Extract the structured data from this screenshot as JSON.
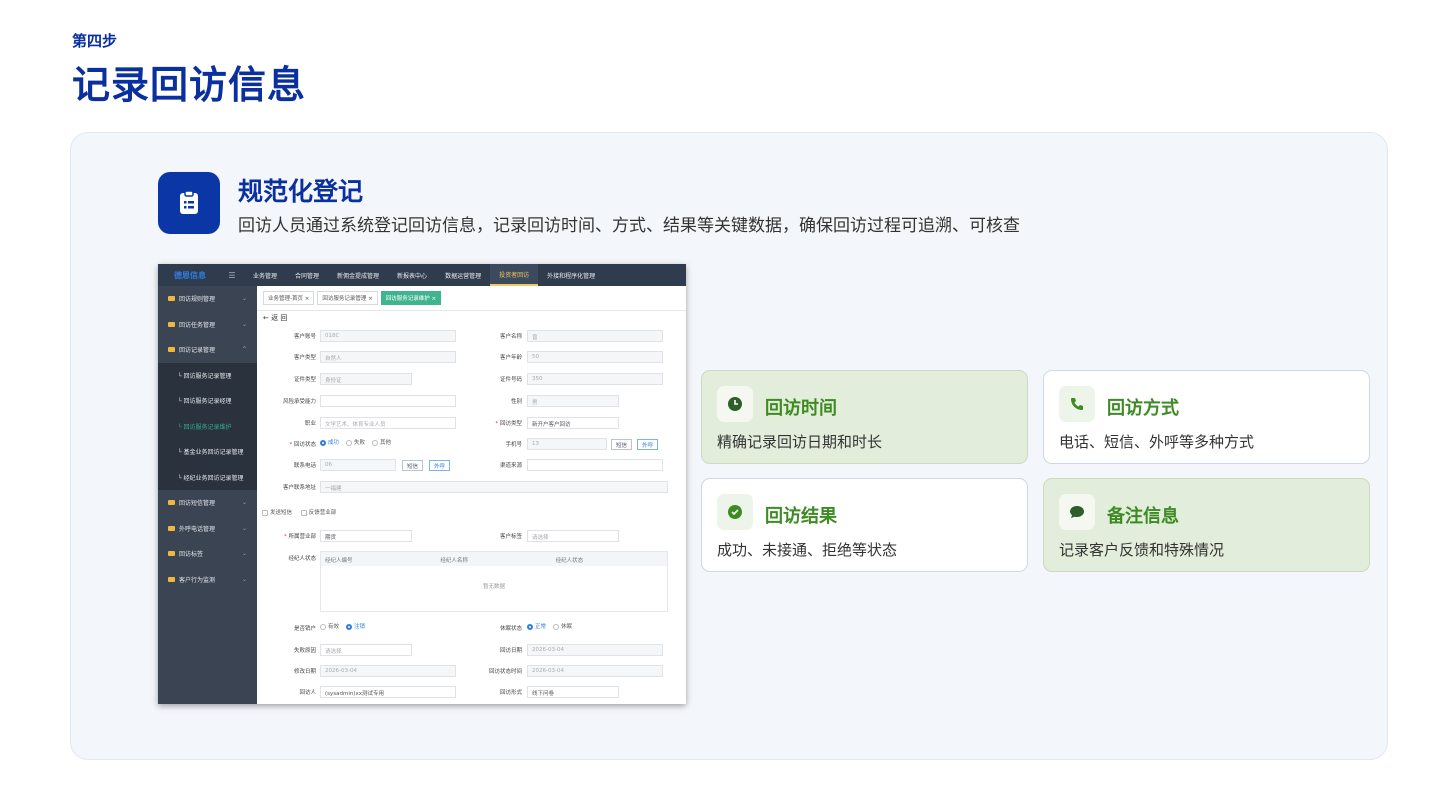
{
  "step_label": "第四步",
  "page_title": "记录回访信息",
  "feature": {
    "title": "规范化登记",
    "description": "回访人员通过系统登记回访信息，记录回访时间、方式、结果等关键数据，确保回访过程可追溯、可核查",
    "icon": "clipboard-icon"
  },
  "screenshot": {
    "logo": "德恩信息",
    "topnav": [
      "业务管理",
      "合同管理",
      "新佣金提成管理",
      "新报表中心",
      "数据运营管理",
      "投资者回访",
      "外接和程序化管理"
    ],
    "topnav_active": "投资者回访",
    "sidebar": [
      {
        "label": "回访规则管理",
        "chev": "⌄"
      },
      {
        "label": "回访任务管理",
        "chev": "⌄"
      },
      {
        "label": "回访记录管理",
        "chev": "^"
      }
    ],
    "sidebar_sub": [
      "└ 回访服务记录管理",
      "└ 回访服务记录经理",
      "└ 回访服务记录维护",
      "└ 基金业务回访记录管理",
      "└ 经纪业务回访记录管理"
    ],
    "sidebar_after": [
      {
        "label": "回访短信管理",
        "chev": "⌄"
      },
      {
        "label": "外呼电话管理",
        "chev": "⌄"
      },
      {
        "label": "回访标签",
        "chev": "⌄"
      },
      {
        "label": "客户行为监测",
        "chev": "⌄"
      }
    ],
    "tabs": [
      "业务管理-首页 ×",
      "回访服务记录管理 ×",
      "回访服务记录维护 ×"
    ],
    "back": "← 返 回",
    "labels": {
      "acct": "客户账号",
      "name": "客户名称",
      "ctype": "客户类型",
      "age": "客户年龄",
      "idtype": "证件类型",
      "idno": "证件号码",
      "risk": "风险承受能力",
      "gender": "性别",
      "job": "职业",
      "vtype": "回访类型",
      "vstatus": "回访状态",
      "mobile": "手机号",
      "phone": "联系电话",
      "source": "渠道来源",
      "addr": "客户联系地址",
      "sms": "发送短信",
      "feedback": "反馈营业部",
      "dept": "所属营业部",
      "tag": "客户标签",
      "broker": "经纪人状态",
      "canceled": "是否销户",
      "dormant": "休眠状态",
      "lost": "失败原因",
      "vdate": "回访日期",
      "mdate": "修改日期",
      "vsdate": "回访状态时间",
      "visitor": "回访人",
      "vform": "回访形式"
    },
    "values": {
      "acct": "018C",
      "name": "曾",
      "ctype": "自然人",
      "age": "50",
      "idtype": "身份证",
      "idno": "350",
      "gender": "男",
      "job": "文学艺术、体育专业人员",
      "vtype": "新开户客户回访",
      "vstatus_opts": [
        "成功",
        "失败",
        "其他"
      ],
      "mobile": "13",
      "phone": "06",
      "addr": "一福建",
      "dept": "期货",
      "tag": "请选择",
      "canceled_opts": [
        "有效",
        "注销"
      ],
      "dormant_opts": [
        "正常",
        "休眠"
      ],
      "lost": "请选择",
      "vdate": "2026-03-04",
      "mdate": "2026-03-04",
      "vsdate": "2026-03-04",
      "visitor": "(sysadmin)xx测试专用",
      "vform": "线下问卷"
    },
    "btn_sms": "短信",
    "btn_call": "外呼",
    "table_headers": [
      "经纪人编号",
      "经纪人名称",
      "经纪人状态"
    ],
    "table_empty": "暂无数据"
  },
  "cards": [
    {
      "title": "回访时间",
      "desc": "精确记录回访日期和时长",
      "icon": "clock-icon",
      "style": "green"
    },
    {
      "title": "回访方式",
      "desc": "电话、短信、外呼等多种方式",
      "icon": "phone-icon",
      "style": "white"
    },
    {
      "title": "回访结果",
      "desc": "成功、未接通、拒绝等状态",
      "icon": "check-circle-icon",
      "style": "white"
    },
    {
      "title": "备注信息",
      "desc": "记录客户反馈和特殊情况",
      "icon": "chat-bubble-icon",
      "style": "green"
    }
  ],
  "colors": {
    "brand": "#0a2f9e",
    "accent_green": "#3e8b24",
    "card_green": "#e2eddb"
  }
}
